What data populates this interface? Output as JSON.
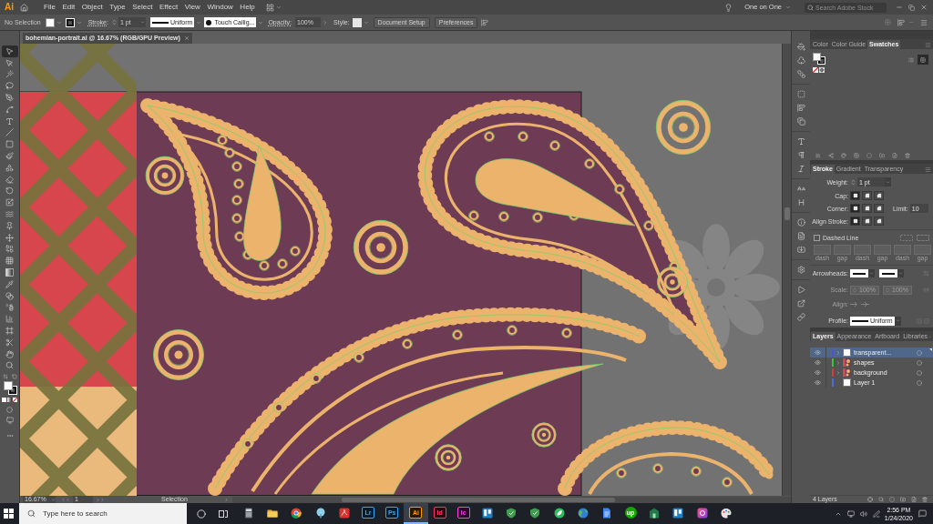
{
  "menu_bar": {
    "logo": "Ai",
    "menus": [
      "File",
      "Edit",
      "Object",
      "Type",
      "Select",
      "Effect",
      "View",
      "Window",
      "Help"
    ],
    "workspace": "One on One",
    "search": {
      "placeholder": "Search Adobe Stock"
    }
  },
  "control_bar": {
    "selection": "No Selection",
    "stroke_label": "Stroke:",
    "stroke_weight": "1 pt",
    "stroke_profile": "Uniform",
    "brush": "Touch Callig...",
    "opacity_label": "Opacity:",
    "opacity": "100%",
    "style_label": "Style:",
    "buttons": [
      "Document Setup",
      "Preferences"
    ]
  },
  "toolbar": {
    "tools": [
      {
        "selected": true
      },
      {
        "selected": false
      },
      {
        "selected": false
      },
      {
        "selected": false
      },
      {
        "selected": false
      },
      {
        "selected": false
      },
      {
        "selected": false
      },
      {
        "selected": false
      },
      {
        "selected": false
      },
      {
        "selected": false
      },
      {
        "selected": false
      },
      {
        "selected": false
      },
      {
        "selected": false
      },
      {
        "selected": false
      },
      {
        "selected": false
      },
      {
        "selected": false
      },
      {
        "selected": false
      },
      {
        "selected": false
      },
      {
        "selected": false
      },
      {
        "selected": false
      },
      {
        "selected": false
      },
      {
        "selected": false
      },
      {
        "selected": false
      },
      {
        "selected": false
      },
      {
        "selected": false
      },
      {
        "selected": false
      },
      {
        "selected": false
      },
      {
        "selected": false
      }
    ]
  },
  "document": {
    "tab": "bohemian-portrait.ai @ 16.67% (RGB/GPU Preview)",
    "status_bar": {
      "zoom": "16.67%",
      "artboard": "1",
      "tool": "Selection"
    }
  },
  "swatches_panel": {
    "tabs": [
      {
        "label": "Color",
        "selected": false
      },
      {
        "label": "Color Guide",
        "selected": false
      },
      {
        "label": "Swatches",
        "selected": true
      }
    ],
    "views": [
      {
        "selected": false
      },
      {
        "selected": true
      }
    ]
  },
  "stroke_panel": {
    "tabs": [
      {
        "label": "Stroke",
        "selected": true
      },
      {
        "label": "Gradient",
        "selected": false
      },
      {
        "label": "Transparency",
        "selected": false
      }
    ],
    "weight": {
      "label": "Weight:",
      "value": "1 pt"
    },
    "cap": {
      "label": "Cap:",
      "options": [
        {
          "selected": true
        },
        {
          "selected": false
        },
        {
          "selected": false
        }
      ]
    },
    "corner": {
      "label": "Corner:",
      "options": [
        {
          "selected": true
        },
        {
          "selected": false
        },
        {
          "selected": false
        }
      ],
      "limit_label": "Limit:",
      "limit": "10"
    },
    "align": {
      "label": "Align Stroke:",
      "options": [
        {
          "selected": true
        },
        {
          "selected": false
        },
        {
          "selected": false
        }
      ]
    },
    "dashed_line": {
      "label": "Dashed Line",
      "checked": false
    },
    "dash_fields": {
      "disabled": true,
      "labels": [
        "dash",
        "gap",
        "dash",
        "gap",
        "dash",
        "gap"
      ]
    },
    "arrowheads": {
      "label": "Arrowheads:"
    },
    "scale": {
      "label": "Scale:",
      "values": [
        "100%",
        "100%"
      ],
      "disabled": true
    },
    "arrow_align": {
      "label": "Align:",
      "disabled": true
    },
    "profile": {
      "label": "Profile:",
      "value": "Uniform"
    }
  },
  "layers_panel": {
    "tabs": [
      {
        "label": "Layers",
        "selected": true
      },
      {
        "label": "Appearance",
        "selected": false
      },
      {
        "label": "Artboard",
        "selected": false
      },
      {
        "label": "Libraries",
        "selected": false
      }
    ],
    "layers": [
      {
        "name": "transparent...",
        "color": "#4a55d8",
        "kind": "group",
        "thumbnail": {
          "kind": "blank"
        },
        "visible": true,
        "selected": true
      },
      {
        "name": "shapes",
        "color": "#3cc43c",
        "kind": "group",
        "thumbnail": {
          "kind": "art"
        },
        "visible": true,
        "selected": false
      },
      {
        "name": "background",
        "color": "#d93a3a",
        "kind": "group",
        "thumbnail": {
          "kind": "art"
        },
        "visible": true,
        "selected": false
      },
      {
        "name": "Layer 1",
        "color": "#4a6ee0",
        "kind": "layer",
        "thumbnail": {
          "kind": "blank"
        },
        "visible": true,
        "selected": false
      }
    ],
    "count": "4 Layers"
  },
  "taskbar": {
    "search": {
      "placeholder": "Type here to search"
    },
    "apps": [
      {
        "kind": "calculator",
        "active": false
      },
      {
        "kind": "folder",
        "active": false
      },
      {
        "kind": "chrome",
        "active": false
      },
      {
        "kind": "tree",
        "active": false
      },
      {
        "kind": "acrobat",
        "active": false
      },
      {
        "kind": "adobe",
        "label": "Lr",
        "color": "#31a8ff",
        "active": false
      },
      {
        "kind": "adobe",
        "label": "Ps",
        "color": "#31a8ff",
        "active": false
      },
      {
        "kind": "adobe",
        "label": "Ai",
        "color": "#ff9a00",
        "active": true
      },
      {
        "kind": "adobe",
        "label": "Id",
        "color": "#ff3366",
        "active": false
      },
      {
        "kind": "adobe",
        "label": "Ic",
        "color": "#ff3ef0",
        "active": false
      },
      {
        "kind": "board",
        "active": false
      },
      {
        "kind": "shield",
        "active": false
      },
      {
        "kind": "shield",
        "active": false
      },
      {
        "kind": "leaf",
        "active": false
      },
      {
        "kind": "globe",
        "active": false
      },
      {
        "kind": "doc",
        "active": false
      },
      {
        "kind": "upwork",
        "label": "up",
        "active": false
      },
      {
        "kind": "building",
        "active": false
      },
      {
        "kind": "board",
        "active": false
      },
      {
        "kind": "app",
        "active": false
      },
      {
        "kind": "palette",
        "active": false
      }
    ],
    "clock": {
      "time": "2:56 PM",
      "date": "1/24/2020"
    }
  }
}
